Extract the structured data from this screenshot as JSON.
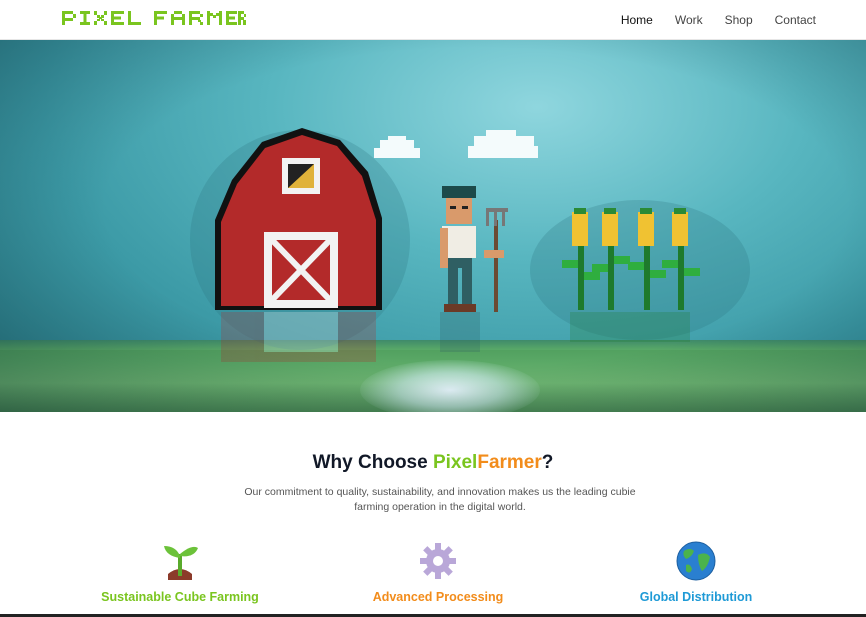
{
  "brand": {
    "name": "PIXEL FARMER",
    "color": "#7ac51f"
  },
  "nav": {
    "items": [
      {
        "label": "Home",
        "active": true
      },
      {
        "label": "Work",
        "active": false
      },
      {
        "label": "Shop",
        "active": false
      },
      {
        "label": "Contact",
        "active": false
      }
    ]
  },
  "hero": {
    "image": "pixel-farm-scene",
    "colors": {
      "sky": "#58b6c0",
      "barn": "#b32a2a",
      "ground": "#5aa866"
    }
  },
  "why": {
    "title_prefix": "Why Choose ",
    "title_pixel": "Pixel",
    "title_farmer": "Farmer",
    "title_suffix": "?",
    "description": "Our commitment to quality, sustainability, and innovation makes us the leading cubie farming operation in the digital world."
  },
  "features": [
    {
      "label": "Sustainable Cube Farming",
      "icon": "seedling-icon",
      "color": "#7ac51f"
    },
    {
      "label": "Advanced Processing",
      "icon": "gear-icon",
      "color": "#f28c1b"
    },
    {
      "label": "Global Distribution",
      "icon": "globe-icon",
      "color": "#1e9ad6"
    }
  ]
}
